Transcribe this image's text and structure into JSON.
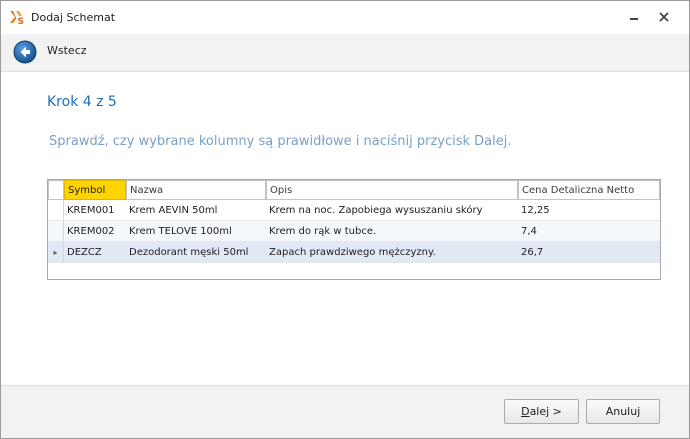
{
  "window": {
    "title": "Dodaj Schemat"
  },
  "nav": {
    "back_label": "Wstecz"
  },
  "wizard": {
    "step": "Krok 4 z 5",
    "instruction": "Sprawdź, czy wybrane kolumny są prawidłowe i naciśnij przycisk Dalej."
  },
  "grid": {
    "columns": [
      "Symbol",
      "Nazwa",
      "Opis",
      "Cena Detaliczna Netto"
    ],
    "selected_column": "Symbol",
    "rows": [
      [
        "KREM001",
        "Krem AEVIN 50ml",
        "Krem na noc. Zapobiega wysuszaniu skóry",
        "12,25"
      ],
      [
        "KREM002",
        "Krem TELOVE 100ml",
        "Krem do rąk w tubce.",
        "7,4"
      ],
      [
        "DEZCZ",
        "Dezodorant męski 50ml",
        "Zapach prawdziwego mężczyzny.",
        "26,7"
      ]
    ],
    "current_row_indicator": "▸"
  },
  "footer": {
    "next_label": "Dalej >",
    "cancel_label": "Anuluj"
  },
  "colors": {
    "accent": "#1e6fb5",
    "selected_header": "#ffd400",
    "instruction_text": "#7aa0c8"
  },
  "icons": {
    "app": "schema-app-icon",
    "back": "back-arrow-icon",
    "minimize": "minimize-icon",
    "close": "close-icon"
  }
}
